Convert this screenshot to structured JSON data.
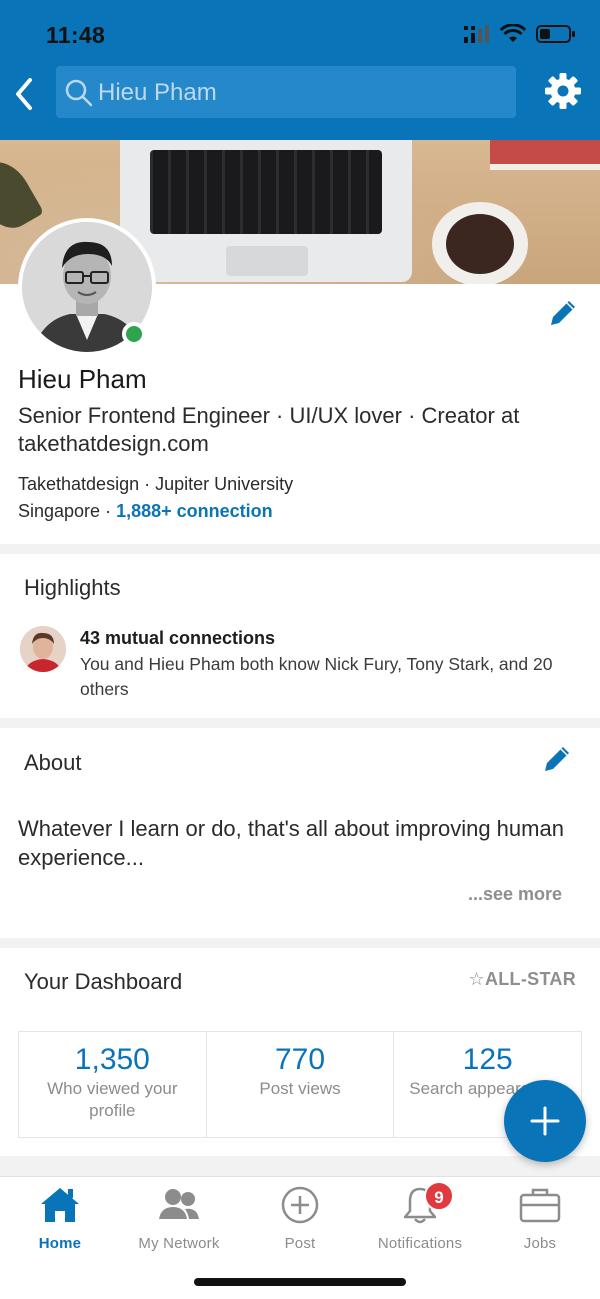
{
  "status_bar": {
    "time": "11:48"
  },
  "header": {
    "search_value": "Hieu Pham",
    "back_icon": "chevron-left-icon",
    "settings_icon": "gear-icon",
    "accent": "#0a74b9"
  },
  "profile": {
    "name": "Hieu Pham",
    "headline": "Senior Frontend Engineer · UI/UX lover · Creator at takethatdesign.com",
    "company_line": "Takethatdesign · Jupiter University",
    "location": "Singapore · ",
    "connections": "1,888+ connection",
    "online_status_color": "#2fa44f"
  },
  "highlights": {
    "title": "Highlights",
    "item_title": "43 mutual connections",
    "item_desc": "You and Hieu Pham both know Nick Fury, Tony Stark, and 20 others"
  },
  "about": {
    "title": "About",
    "text": "Whatever I learn or do, that's all about improving human experience...",
    "see_more": "...see more"
  },
  "dashboard": {
    "title": "Your Dashboard",
    "badge": "☆ALL-STAR",
    "stats": [
      {
        "value": "1,350",
        "label": "Who viewed your profile"
      },
      {
        "value": "770",
        "label": "Post views"
      },
      {
        "value": "125",
        "label": "Search appearances"
      }
    ]
  },
  "fab": {
    "icon": "plus-icon"
  },
  "tabs": [
    {
      "label": "Home",
      "icon": "home-icon"
    },
    {
      "label": "My Network",
      "icon": "people-icon"
    },
    {
      "label": "Post",
      "icon": "add-circle-icon"
    },
    {
      "label": "Notifications",
      "icon": "bell-icon",
      "badge": "9"
    },
    {
      "label": "Jobs",
      "icon": "briefcase-icon"
    }
  ]
}
